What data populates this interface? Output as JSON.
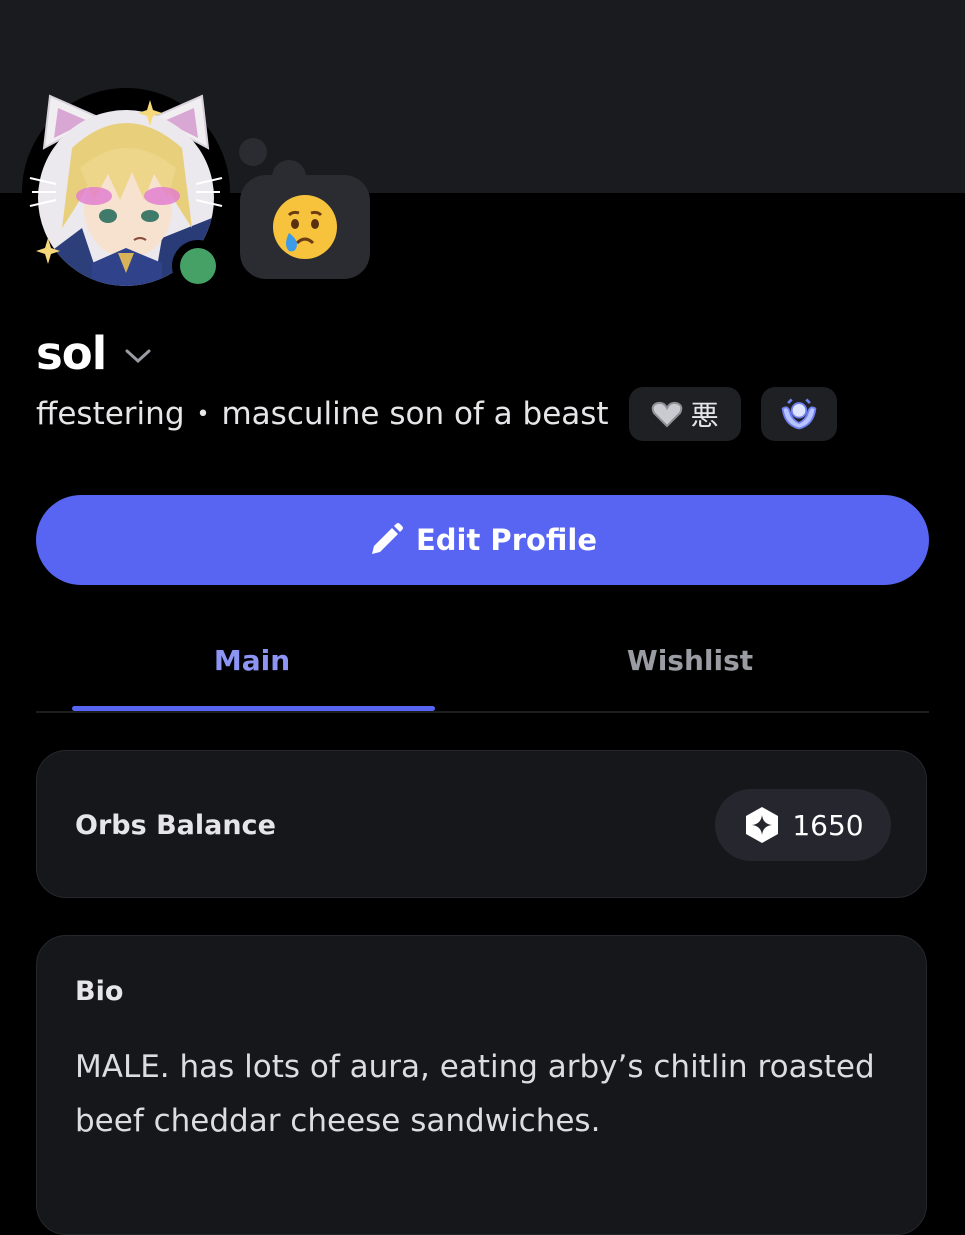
{
  "profile": {
    "username": "sol",
    "pronoun_handle": "ffestering",
    "separator": "•",
    "tagline": "masculine son of a beast",
    "status_emoji": "😢",
    "status": "online",
    "clan_tag": "悪",
    "icons": {
      "username_dropdown": "chevron-down-icon",
      "clan_badge": "heart-icon",
      "nitro_badge": "laurel-icon",
      "orbs": "orb-icon",
      "edit": "pencil-icon"
    }
  },
  "actions": {
    "edit_profile_label": "Edit Profile"
  },
  "tabs": [
    {
      "label": "Main",
      "active": true
    },
    {
      "label": "Wishlist",
      "active": false
    }
  ],
  "orbs": {
    "label": "Orbs Balance",
    "value": "1650"
  },
  "bio": {
    "title": "Bio",
    "text": "MALE. has lots of aura, eating arby’s chitlin roasted beef cheddar cheese sandwiches."
  },
  "colors": {
    "accent": "#5865f2",
    "tab_active": "#8c95f3",
    "status_online": "#45a165",
    "background": "#000000",
    "card": "#16171b"
  }
}
